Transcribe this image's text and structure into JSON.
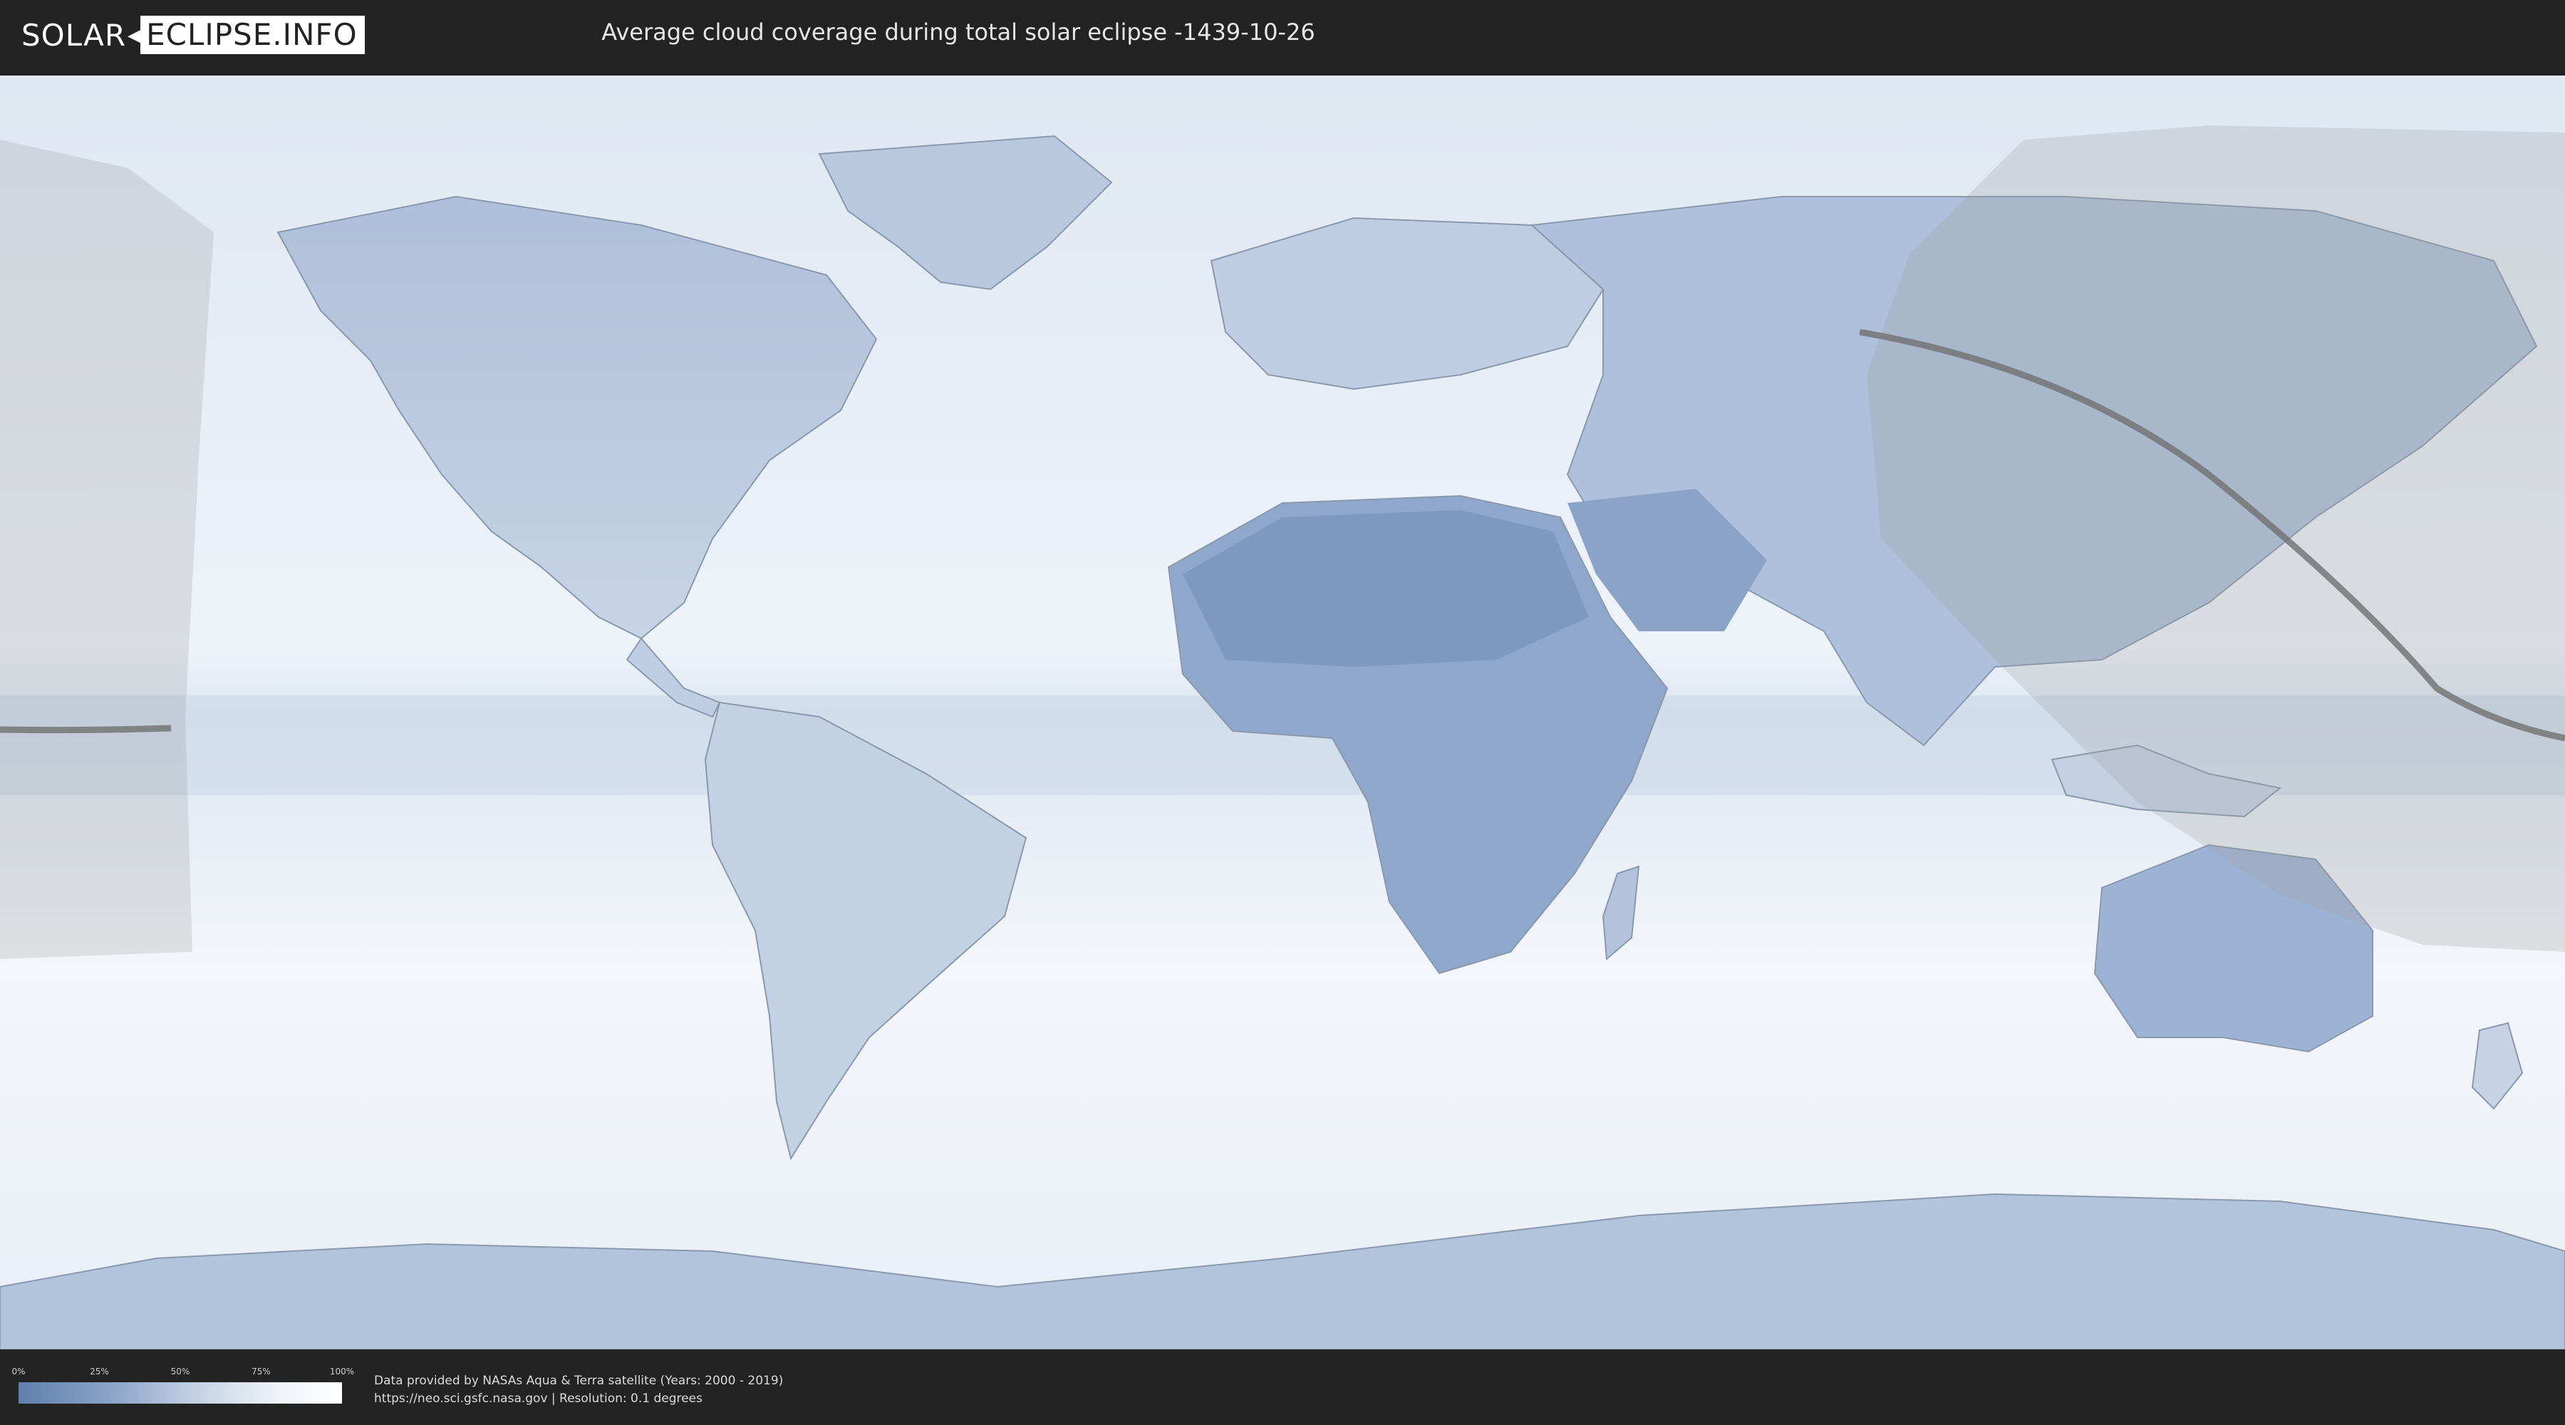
{
  "header": {
    "logo": {
      "part1": "SOLAR",
      "part2": "ECLIPSE.INFO"
    },
    "title": "Average cloud coverage during total solar eclipse -1439-10-26"
  },
  "map": {
    "colors": {
      "ocean_clouds": "#e9eff7",
      "clear_sky": "#6b87b3",
      "eclipse_overlay": "#9a9a9a",
      "path_line": "#6f6f6f",
      "border": "#8a98ad"
    },
    "icons": [
      "world-map",
      "eclipse-path-line",
      "eclipse-visibility-shadow"
    ]
  },
  "legend": {
    "ticks": [
      "0%",
      "25%",
      "50%",
      "75%",
      "100%"
    ],
    "gradient": [
      "#5f7fae",
      "#ffffff"
    ]
  },
  "footer": {
    "credit_line1": "Data provided by NASAs Aqua & Terra satellite (Years: 2000 - 2019)",
    "credit_line2": "https://neo.sci.gsfc.nasa.gov | Resolution: 0.1 degrees"
  }
}
